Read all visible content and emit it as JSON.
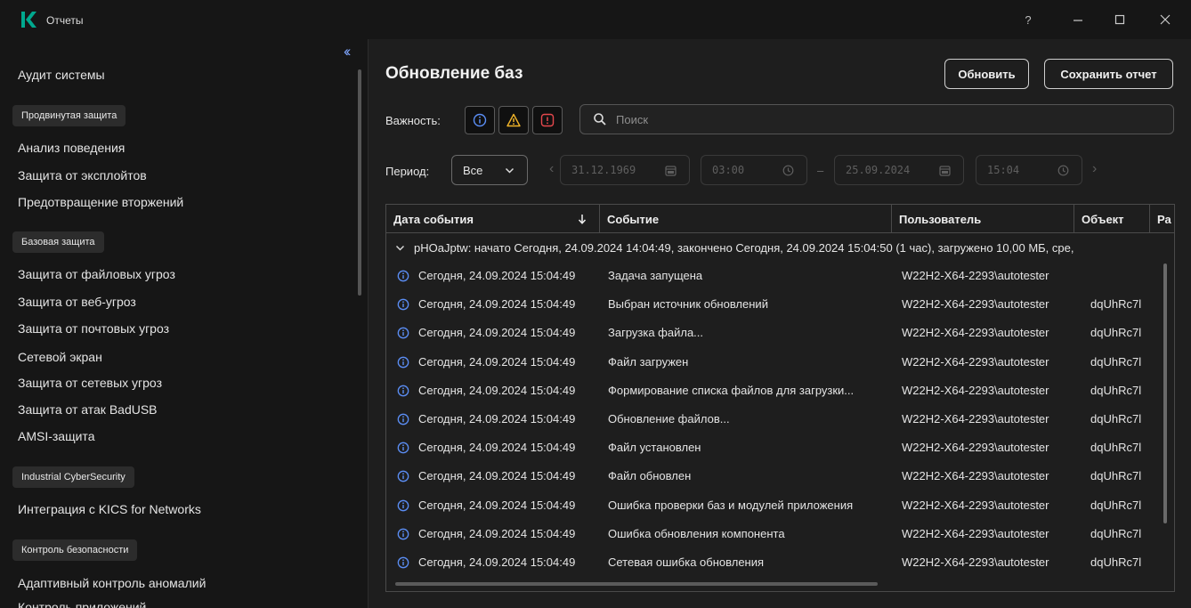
{
  "window": {
    "title": "Отчеты",
    "help": "?",
    "brand_color": "#00a88e"
  },
  "sidebar": {
    "collapse_label": "‹‹",
    "top_item": "Аудит системы",
    "groups": [
      {
        "label": "Продвинутая защита",
        "items": [
          "Анализ поведения",
          "Защита от эксплойтов",
          "Предотвращение вторжений"
        ]
      },
      {
        "label": "Базовая защита",
        "items": [
          "Защита от файловых угроз",
          "Защита от веб-угроз",
          "Защита от почтовых угроз",
          "Сетевой экран",
          "Защита от сетевых угроз",
          "Защита от атак BadUSB",
          "AMSI-защита"
        ]
      },
      {
        "label": "Industrial CyberSecurity",
        "items": [
          "Интеграция с KICS for Networks"
        ]
      },
      {
        "label": "Контроль безопасности",
        "items": [
          "Адаптивный контроль аномалий",
          "Контроль приложений"
        ]
      }
    ]
  },
  "main": {
    "title": "Обновление баз",
    "refresh_label": "Обновить",
    "save_label": "Сохранить отчет",
    "severity_label": "Важность:",
    "search_placeholder": "Поиск",
    "period_label": "Период:",
    "period_value": "Все",
    "date_from": "31.12.1969",
    "time_from": "03:00",
    "dash": "–",
    "date_to": "25.09.2024",
    "time_to": "15:04",
    "colors": {
      "info": "#5b8ef5",
      "warning": "#f0b429",
      "critical": "#e5484d"
    }
  },
  "table": {
    "columns": [
      "Дата события",
      "Событие",
      "Пользователь",
      "Объект",
      "Ра"
    ],
    "group_text": "pHOaJptw: начато Сегодня, 24.09.2024 14:04:49, закончено Сегодня, 24.09.2024 15:04:50 (1 час), загружено 10,00 МБ, сре,",
    "rows": [
      {
        "date": "Сегодня, 24.09.2024 15:04:49",
        "event": "Задача запущена",
        "user": "W22H2-X64-2293\\autotester",
        "object": ""
      },
      {
        "date": "Сегодня, 24.09.2024 15:04:49",
        "event": "Выбран источник обновлений",
        "user": "W22H2-X64-2293\\autotester",
        "object": "dqUhRc7l"
      },
      {
        "date": "Сегодня, 24.09.2024 15:04:49",
        "event": "Загрузка файла...",
        "user": "W22H2-X64-2293\\autotester",
        "object": "dqUhRc7l"
      },
      {
        "date": "Сегодня, 24.09.2024 15:04:49",
        "event": "Файл загружен",
        "user": "W22H2-X64-2293\\autotester",
        "object": "dqUhRc7l"
      },
      {
        "date": "Сегодня, 24.09.2024 15:04:49",
        "event": "Формирование списка файлов для загрузки...",
        "user": "W22H2-X64-2293\\autotester",
        "object": "dqUhRc7l"
      },
      {
        "date": "Сегодня, 24.09.2024 15:04:49",
        "event": "Обновление файлов...",
        "user": "W22H2-X64-2293\\autotester",
        "object": "dqUhRc7l"
      },
      {
        "date": "Сегодня, 24.09.2024 15:04:49",
        "event": "Файл установлен",
        "user": "W22H2-X64-2293\\autotester",
        "object": "dqUhRc7l"
      },
      {
        "date": "Сегодня, 24.09.2024 15:04:49",
        "event": "Файл обновлен",
        "user": "W22H2-X64-2293\\autotester",
        "object": "dqUhRc7l"
      },
      {
        "date": "Сегодня, 24.09.2024 15:04:49",
        "event": "Ошибка проверки баз и модулей приложения",
        "user": "W22H2-X64-2293\\autotester",
        "object": "dqUhRc7l"
      },
      {
        "date": "Сегодня, 24.09.2024 15:04:49",
        "event": "Ошибка обновления компонента",
        "user": "W22H2-X64-2293\\autotester",
        "object": "dqUhRc7l"
      },
      {
        "date": "Сегодня, 24.09.2024 15:04:49",
        "event": "Сетевая ошибка обновления",
        "user": "W22H2-X64-2293\\autotester",
        "object": "dqUhRc7l"
      }
    ]
  }
}
